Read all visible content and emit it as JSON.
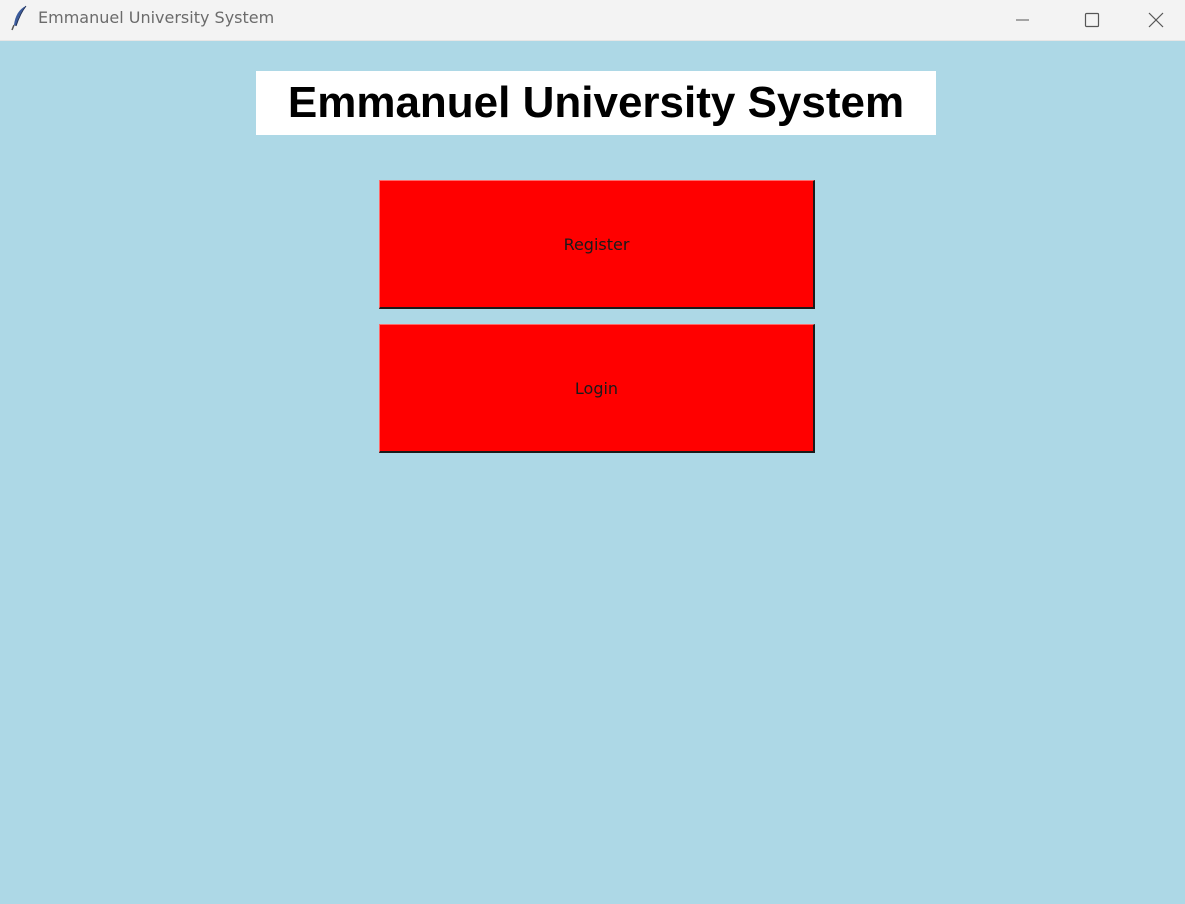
{
  "window": {
    "title": "Emmanuel University System",
    "icon": "feather-icon",
    "controls": {
      "minimize": "minimize-icon",
      "maximize": "maximize-icon",
      "close": "close-icon"
    },
    "background": "#add8e6"
  },
  "main": {
    "heading": "Emmanuel University System",
    "buttons": {
      "register_label": "Register",
      "login_label": "Login"
    },
    "button_color": "#ff0000"
  }
}
